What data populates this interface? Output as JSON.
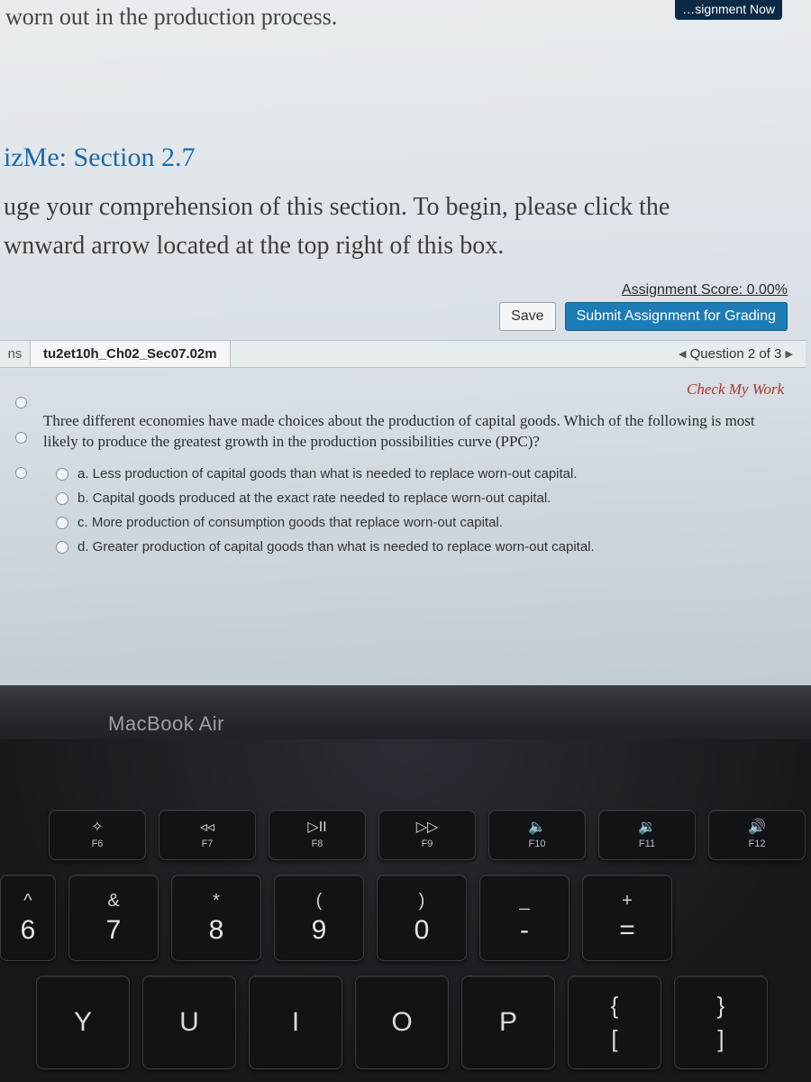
{
  "top_fragment": "worn out in the production process.",
  "badge": "…signment Now",
  "section_title": "izMe: Section 2.7",
  "instructions_line1": "uge your comprehension of this section. To begin, please click the",
  "instructions_line2": "wnward arrow located at the top right of this box.",
  "assignment_score": "Assignment Score: 0.00%",
  "buttons": {
    "save": "Save",
    "submit": "Submit Assignment for Grading"
  },
  "tabs": {
    "stub": "ns",
    "active": "tu2et10h_Ch02_Sec07.02m",
    "nav": "Question 2 of 3"
  },
  "check_my_work": "Check My Work",
  "question": "Three different economies have made choices about the production of capital goods. Which of the following is most likely to produce the greatest growth in the production possibilities curve (PPC)?",
  "answers": [
    "a. Less production of capital goods than what is needed to replace worn-out capital.",
    "b. Capital goods produced at the exact rate needed to replace worn-out capital.",
    "c. More production of consumption goods that replace worn-out capital.",
    "d. Greater production of capital goods than what is needed to replace worn-out capital."
  ],
  "laptop_label": "MacBook Air",
  "fn_keys": [
    {
      "glyph": "✧",
      "label": "F6"
    },
    {
      "glyph": "◃◃",
      "label": "F7"
    },
    {
      "glyph": "▷II",
      "label": "F8"
    },
    {
      "glyph": "▷▷",
      "label": "F9"
    },
    {
      "glyph": "🔈",
      "label": "F10"
    },
    {
      "glyph": "🔉",
      "label": "F11"
    },
    {
      "glyph": "🔊",
      "label": "F12"
    }
  ],
  "num_keys": [
    {
      "upper": "^",
      "lower": "6",
      "narrow": true
    },
    {
      "upper": "&",
      "lower": "7"
    },
    {
      "upper": "*",
      "lower": "8"
    },
    {
      "upper": "(",
      "lower": "9"
    },
    {
      "upper": ")",
      "lower": "0"
    },
    {
      "upper": "_",
      "lower": "-"
    },
    {
      "upper": "+",
      "lower": "="
    }
  ],
  "letter_keys": [
    {
      "main": "Y"
    },
    {
      "main": "U"
    },
    {
      "main": "I"
    },
    {
      "main": "O"
    },
    {
      "main": "P"
    },
    {
      "upper": "{",
      "lower": "["
    },
    {
      "upper": "}",
      "lower": "]"
    }
  ]
}
